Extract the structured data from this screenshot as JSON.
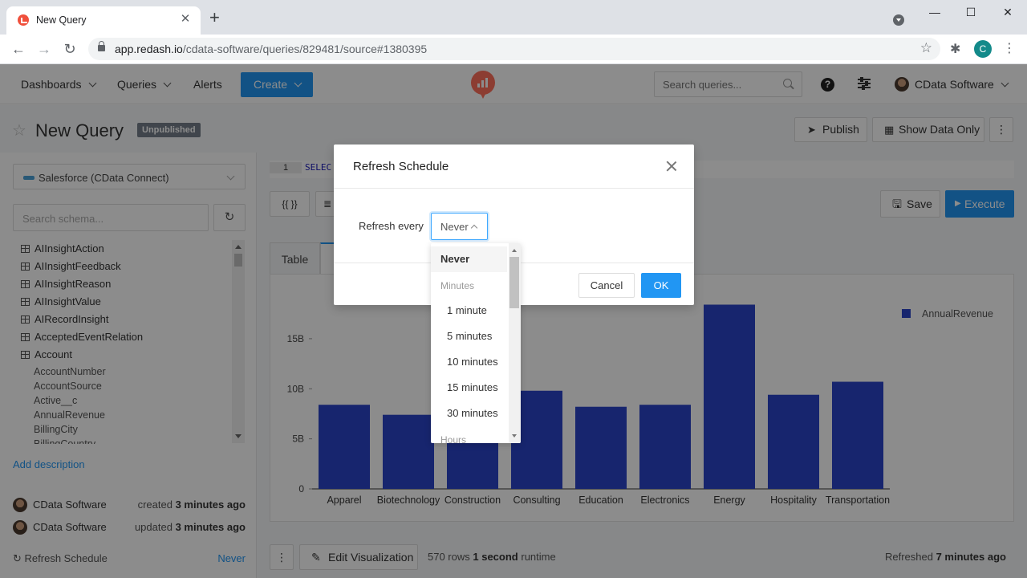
{
  "browser": {
    "tab_title": "New Query",
    "url_host": "app.redash.io",
    "url_path": "/cdata-software/queries/829481/source#1380395",
    "profile_initial": "C"
  },
  "header": {
    "nav": [
      "Dashboards",
      "Queries",
      "Alerts"
    ],
    "create_label": "Create",
    "search_placeholder": "Search queries...",
    "user_name": "CData Software"
  },
  "page": {
    "title": "New Query",
    "badge": "Unpublished",
    "publish_label": "Publish",
    "show_data_label": "Show Data Only"
  },
  "sidebar": {
    "data_source": "Salesforce (CData Connect)",
    "schema_search_placeholder": "Search schema...",
    "schema": [
      {
        "type": "table",
        "name": "AIInsightAction"
      },
      {
        "type": "table",
        "name": "AIInsightFeedback"
      },
      {
        "type": "table",
        "name": "AIInsightReason"
      },
      {
        "type": "table",
        "name": "AIInsightValue"
      },
      {
        "type": "table",
        "name": "AIRecordInsight"
      },
      {
        "type": "table",
        "name": "AcceptedEventRelation"
      },
      {
        "type": "table",
        "name": "Account"
      },
      {
        "type": "field",
        "name": "AccountNumber"
      },
      {
        "type": "field",
        "name": "AccountSource"
      },
      {
        "type": "field",
        "name": "Active__c"
      },
      {
        "type": "field",
        "name": "AnnualRevenue"
      },
      {
        "type": "field",
        "name": "BillingCity"
      },
      {
        "type": "field",
        "name": "BillingCountry"
      }
    ],
    "add_description": "Add description",
    "created_by": "CData Software",
    "created_prefix": "created",
    "created_when": "3 minutes ago",
    "updated_by": "CData Software",
    "updated_prefix": "updated",
    "updated_when": "3 minutes ago",
    "refresh_schedule_label": "Refresh Schedule",
    "refresh_schedule_value": "Never"
  },
  "editor": {
    "line_number": "1",
    "code": "SELEC",
    "params_label": "{{ }}",
    "save_label": "Save",
    "execute_label": "Execute"
  },
  "viz": {
    "tab_table": "Table",
    "edit_label": "Edit Visualization",
    "rows_count": "570 rows",
    "runtime": "1 second",
    "runtime_suffix": "runtime",
    "refreshed_prefix": "Refreshed",
    "refreshed_when": "7 minutes ago"
  },
  "modal": {
    "title": "Refresh Schedule",
    "refresh_every_label": "Refresh every",
    "selected_value": "Never",
    "cancel_label": "Cancel",
    "ok_label": "OK"
  },
  "dropdown": {
    "items": [
      {
        "kind": "option",
        "label": "Never",
        "selected": true
      },
      {
        "kind": "group",
        "label": "Minutes"
      },
      {
        "kind": "option",
        "label": "1 minute"
      },
      {
        "kind": "option",
        "label": "5 minutes"
      },
      {
        "kind": "option",
        "label": "10 minutes"
      },
      {
        "kind": "option",
        "label": "15 minutes"
      },
      {
        "kind": "option",
        "label": "30 minutes"
      },
      {
        "kind": "group",
        "label": "Hours"
      }
    ]
  },
  "colors": {
    "accent": "#2196f3",
    "bar": "#2b44c9",
    "logo": "#ff6f5c"
  },
  "chart_data": {
    "type": "bar",
    "categories": [
      "Apparel",
      "Biotechnology",
      "Construction",
      "Consulting",
      "Education",
      "Electronics",
      "Energy",
      "Hospitality",
      "Transportation"
    ],
    "series": [
      {
        "name": "AnnualRevenue",
        "values": [
          8.4,
          7.4,
          7.7,
          9.8,
          8.2,
          8.4,
          18.4,
          9.4,
          10.7
        ]
      }
    ],
    "y_unit": "B",
    "yticks": [
      "0",
      "5B",
      "10B",
      "15B"
    ],
    "ylim": [
      0,
      19
    ],
    "legend": "top-right",
    "grid": false
  }
}
